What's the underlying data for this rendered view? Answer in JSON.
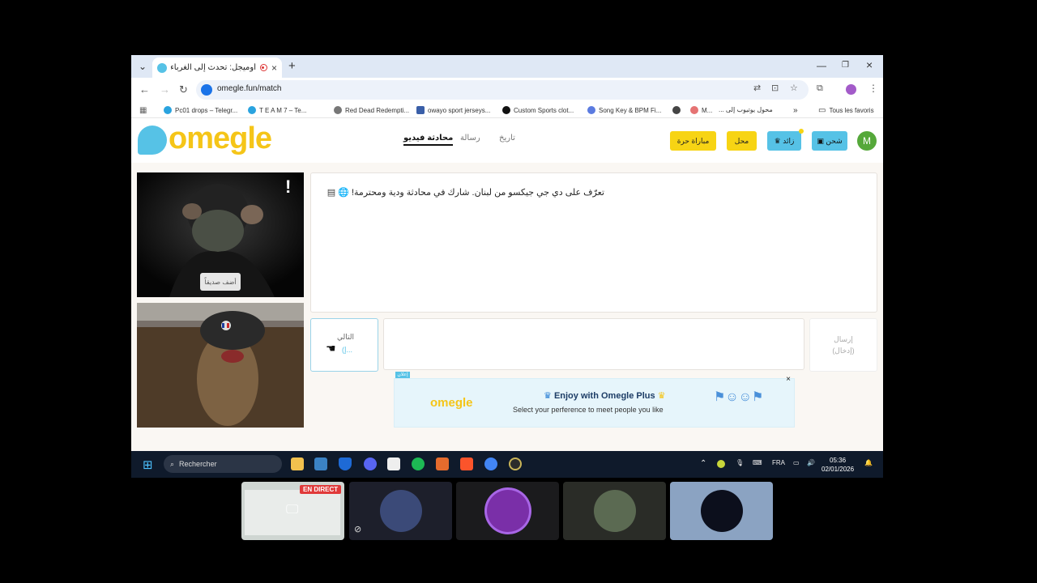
{
  "browser": {
    "tab_title": "أوميجل: تحدث إلى الغرباء عبر",
    "url": "omegle.fun/match",
    "bookmarks": [
      "Pc01 drops – Telegr...",
      "T E A M 7 – Te...",
      "Red Dead Redempti...",
      "owayo sport jerseys...",
      "Custom Sports clot...",
      "Song Key & BPM Fi...",
      "M...",
      "محول يوتيوب إلى ...",
      "Tous les favoris"
    ]
  },
  "header": {
    "logo_text": "omegle",
    "nav": [
      "محادثة فيديو",
      "رسالة",
      "تاريخ"
    ],
    "buttons": [
      "مباراة حرة",
      "محل",
      "زائد",
      "شحن"
    ],
    "avatar_letter": "M"
  },
  "video": {
    "add_friend": "أضف صديقاً",
    "report": "!"
  },
  "chat": {
    "message": "تعرّف على دي جي جيكسو من لبنان. شارك في محادثة ودية ومحترمة!",
    "next_label": "التالي",
    "next_shortcut": "(إ...",
    "send_label": "إرسال",
    "send_shortcut": "(إدخال)"
  },
  "ad": {
    "tag": "إعلان",
    "logo": "omegle",
    "title": "Enjoy with Omegle Plus",
    "subtitle": "Select your perference to meet people you like",
    "close": "×"
  },
  "taskbar": {
    "search": "Rechercher",
    "lang": "FRA",
    "time": "05:36",
    "date": "02/01/2026"
  },
  "meeting": {
    "live_badge": "EN DIRECT"
  }
}
